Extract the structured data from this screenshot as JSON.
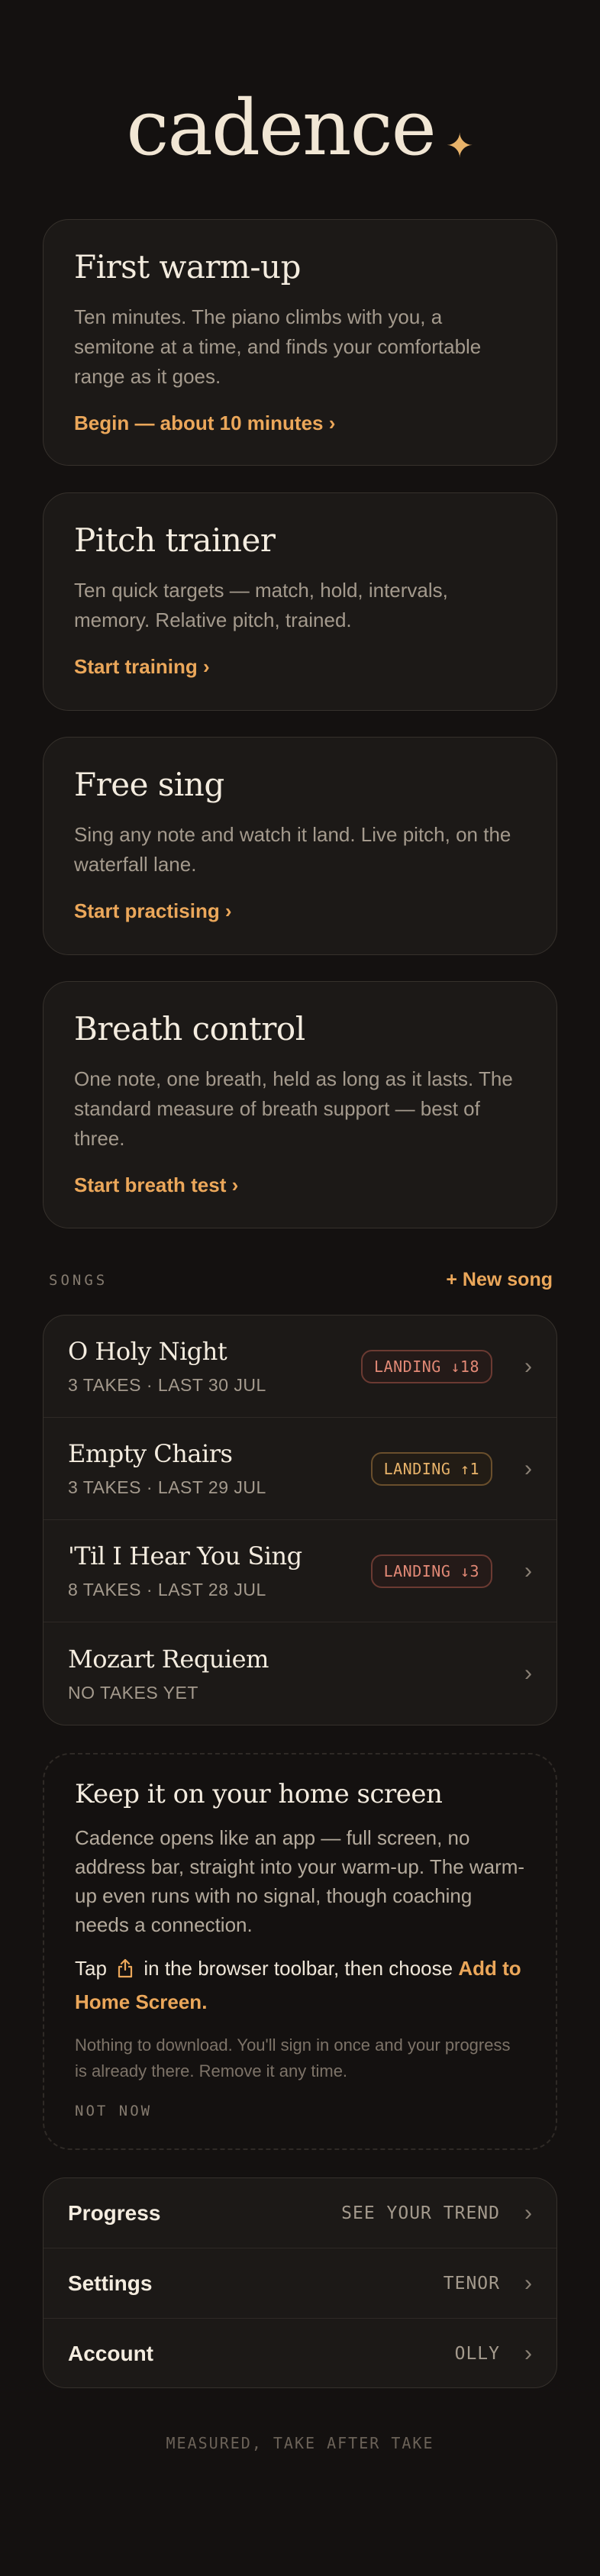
{
  "app": {
    "logo_text": "cadence",
    "logo_icon": "sparkle-icon",
    "accent_color": "#eba75a"
  },
  "cards": [
    {
      "title": "First warm-up",
      "description": "Ten minutes. The piano climbs with you, a semitone at a time, and finds your comfortable range as it goes.",
      "link": "Begin — about 10 minutes ›"
    },
    {
      "title": "Pitch trainer",
      "description": "Ten quick targets — match, hold, intervals, memory. Relative pitch, trained.",
      "link": "Start training ›"
    },
    {
      "title": "Free sing",
      "description": "Sing any note and watch it land. Live pitch, on the waterfall lane.",
      "link": "Start practising ›"
    },
    {
      "title": "Breath control",
      "description": "One note, one breath, held as long as it lasts. The standard measure of breath support — best of three.",
      "link": "Start breath test ›"
    }
  ],
  "songs": {
    "section_label": "SONGS",
    "new_song_label": "+ New song",
    "items": [
      {
        "title": "O Holy Night",
        "meta": "3 TAKES · LAST 30 JUL",
        "badge": "LANDING ↓18",
        "badge_tone": "down"
      },
      {
        "title": "Empty Chairs",
        "meta": "3 TAKES · LAST 29 JUL",
        "badge": "LANDING ↑1",
        "badge_tone": "up"
      },
      {
        "title": "'Til I Hear You Sing",
        "meta": "8 TAKES · LAST 28 JUL",
        "badge": "LANDING ↓3",
        "badge_tone": "down"
      },
      {
        "title": "Mozart Requiem",
        "meta": "NO TAKES YET",
        "badge": "",
        "badge_tone": ""
      }
    ]
  },
  "install_tip": {
    "title": "Keep it on your home screen",
    "body": "Cadence opens like an app — full screen, no address bar, straight into your warm-up. The warm-up even runs with no signal, though coaching needs a connection.",
    "instr_before": "Tap",
    "instr_icon": "share-icon",
    "instr_middle": "in the browser toolbar, then choose",
    "instr_highlight": "Add to Home Screen",
    "instr_end": ".",
    "note": "Nothing to download. You'll sign in once and your progress is already there. Remove it any time.",
    "dismiss_label": "NOT NOW"
  },
  "settings": [
    {
      "label": "Progress",
      "value": "SEE YOUR TREND"
    },
    {
      "label": "Settings",
      "value": "TENOR"
    },
    {
      "label": "Account",
      "value": "OLLY"
    }
  ],
  "footer": "MEASURED, TAKE AFTER TAKE"
}
